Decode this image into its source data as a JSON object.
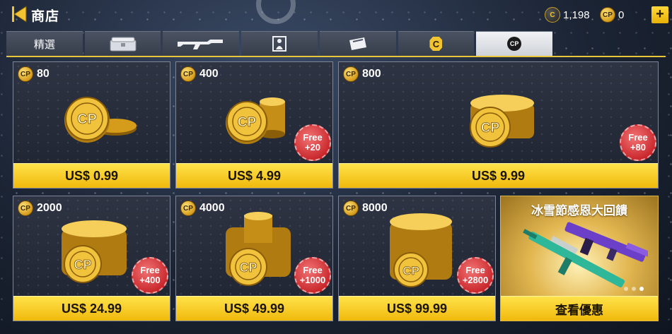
{
  "header": {
    "title": "商店",
    "currency_c": "1,198",
    "currency_cp": "0",
    "plus_label": "+"
  },
  "tabs": [
    {
      "label": "精選",
      "icon": "featured-text"
    },
    {
      "label": "",
      "icon": "crate-icon"
    },
    {
      "label": "",
      "icon": "rifle-icon"
    },
    {
      "label": "",
      "icon": "character-icon"
    },
    {
      "label": "",
      "icon": "ticket-icon"
    },
    {
      "label": "",
      "icon": "c-currency-icon"
    },
    {
      "label": "",
      "icon": "cp-currency-icon",
      "active": true
    }
  ],
  "cp_glyph": "CP",
  "c_glyph": "C",
  "packs": [
    {
      "amount": "80",
      "price": "US$ 0.99"
    },
    {
      "amount": "400",
      "price": "US$ 4.99",
      "badge_top": "Free",
      "badge_bottom": "+20"
    },
    {
      "amount": "800",
      "price": "US$ 9.99",
      "badge_top": "Free",
      "badge_bottom": "+80"
    },
    {
      "amount": "2000",
      "price": "US$ 24.99",
      "badge_top": "Free",
      "badge_bottom": "+400"
    },
    {
      "amount": "4000",
      "price": "US$ 49.99",
      "badge_top": "Free",
      "badge_bottom": "+1000"
    },
    {
      "amount": "8000",
      "price": "US$ 99.99",
      "badge_top": "Free",
      "badge_bottom": "+2800"
    }
  ],
  "promo": {
    "title": "冰雪節感恩大回饋",
    "button_label": "查看優惠"
  },
  "colors": {
    "accent_yellow": "#f0b90c",
    "badge_red": "#c8262b",
    "tab_active": "#e4e6ea"
  }
}
